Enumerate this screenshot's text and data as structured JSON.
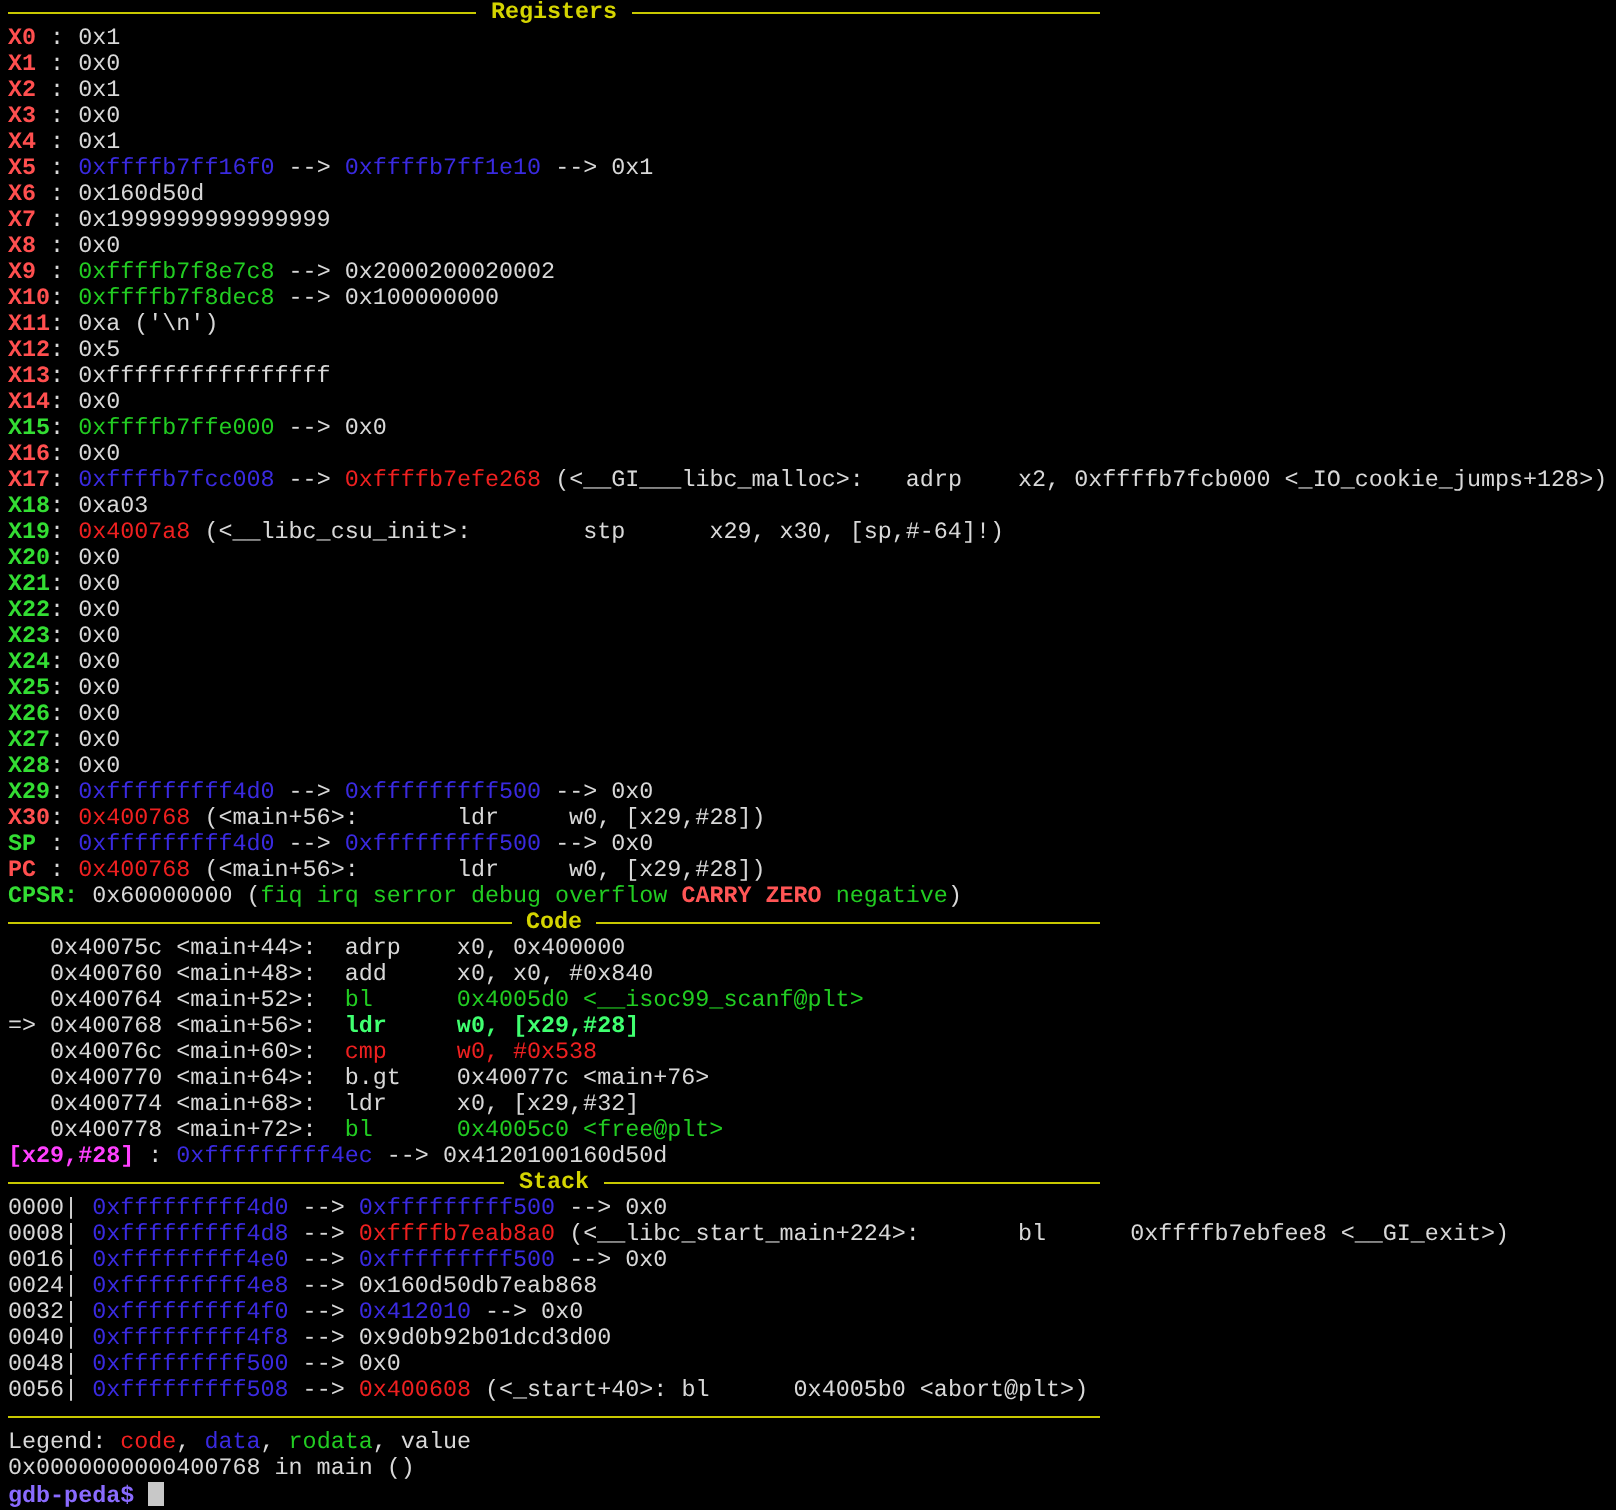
{
  "panels": [
    {
      "title": "Registers",
      "lines": [
        [
          {
            "text": "X0",
            "kind": "reg_changed"
          },
          {
            "text": " : 0x1"
          }
        ],
        [
          {
            "text": "X1",
            "kind": "reg_changed"
          },
          {
            "text": " : 0x0"
          }
        ],
        [
          {
            "text": "X2",
            "kind": "reg_changed"
          },
          {
            "text": " : 0x1"
          }
        ],
        [
          {
            "text": "X3",
            "kind": "reg_changed"
          },
          {
            "text": " : 0x0"
          }
        ],
        [
          {
            "text": "X4",
            "kind": "reg_changed"
          },
          {
            "text": " : 0x1"
          }
        ],
        [
          {
            "text": "X5",
            "kind": "reg_changed"
          },
          {
            "text": " : "
          },
          {
            "text": "0xffffb7ff16f0",
            "kind": "data"
          },
          {
            "text": " --> "
          },
          {
            "text": "0xffffb7ff1e10",
            "kind": "data"
          },
          {
            "text": " --> 0x1"
          }
        ],
        [
          {
            "text": "X6",
            "kind": "reg_changed"
          },
          {
            "text": " : 0x160d50d"
          }
        ],
        [
          {
            "text": "X7",
            "kind": "reg_changed"
          },
          {
            "text": " : 0x1999999999999999"
          }
        ],
        [
          {
            "text": "X8",
            "kind": "reg_changed"
          },
          {
            "text": " : 0x0"
          }
        ],
        [
          {
            "text": "X9",
            "kind": "reg_changed"
          },
          {
            "text": " : "
          },
          {
            "text": "0xffffb7f8e7c8",
            "kind": "rodata"
          },
          {
            "text": " --> 0x2000200020002"
          }
        ],
        [
          {
            "text": "X10",
            "kind": "reg_changed"
          },
          {
            "text": ": "
          },
          {
            "text": "0xffffb7f8dec8",
            "kind": "rodata"
          },
          {
            "text": " --> 0x100000000"
          }
        ],
        [
          {
            "text": "X11",
            "kind": "reg_changed"
          },
          {
            "text": ": 0xa ('\\n')"
          }
        ],
        [
          {
            "text": "X12",
            "kind": "reg_changed"
          },
          {
            "text": ": 0x5"
          }
        ],
        [
          {
            "text": "X13",
            "kind": "reg_changed"
          },
          {
            "text": ": 0xffffffffffffffff"
          }
        ],
        [
          {
            "text": "X14",
            "kind": "reg_changed"
          },
          {
            "text": ": 0x0"
          }
        ],
        [
          {
            "text": "X15",
            "kind": "reg"
          },
          {
            "text": ": "
          },
          {
            "text": "0xffffb7ffe000",
            "kind": "rodata"
          },
          {
            "text": " --> 0x0"
          }
        ],
        [
          {
            "text": "X16",
            "kind": "reg_changed"
          },
          {
            "text": ": 0x0"
          }
        ],
        [
          {
            "text": "X17",
            "kind": "reg_changed"
          },
          {
            "text": ": "
          },
          {
            "text": "0xffffb7fcc008",
            "kind": "data"
          },
          {
            "text": " --> "
          },
          {
            "text": "0xffffb7efe268",
            "kind": "code"
          },
          {
            "text": " (<__GI___libc_malloc>:   adrp    x2, 0xffffb7fcb000 <_IO_cookie_jumps+128>)"
          }
        ],
        [
          {
            "text": "X18",
            "kind": "reg"
          },
          {
            "text": ": 0xa03"
          }
        ],
        [
          {
            "text": "X19",
            "kind": "reg"
          },
          {
            "text": ": "
          },
          {
            "text": "0x4007a8",
            "kind": "code"
          },
          {
            "text": " (<__libc_csu_init>:        stp      x29, x30, [sp,#-64]!)"
          }
        ],
        [
          {
            "text": "X20",
            "kind": "reg"
          },
          {
            "text": ": 0x0"
          }
        ],
        [
          {
            "text": "X21",
            "kind": "reg"
          },
          {
            "text": ": 0x0"
          }
        ],
        [
          {
            "text": "X22",
            "kind": "reg"
          },
          {
            "text": ": 0x0"
          }
        ],
        [
          {
            "text": "X23",
            "kind": "reg"
          },
          {
            "text": ": 0x0"
          }
        ],
        [
          {
            "text": "X24",
            "kind": "reg"
          },
          {
            "text": ": 0x0"
          }
        ],
        [
          {
            "text": "X25",
            "kind": "reg"
          },
          {
            "text": ": 0x0"
          }
        ],
        [
          {
            "text": "X26",
            "kind": "reg"
          },
          {
            "text": ": 0x0"
          }
        ],
        [
          {
            "text": "X27",
            "kind": "reg"
          },
          {
            "text": ": 0x0"
          }
        ],
        [
          {
            "text": "X28",
            "kind": "reg"
          },
          {
            "text": ": 0x0"
          }
        ],
        [
          {
            "text": "X29",
            "kind": "reg"
          },
          {
            "text": ": "
          },
          {
            "text": "0xfffffffff4d0",
            "kind": "data"
          },
          {
            "text": " --> "
          },
          {
            "text": "0xfffffffff500",
            "kind": "data"
          },
          {
            "text": " --> 0x0"
          }
        ],
        [
          {
            "text": "X30",
            "kind": "reg_changed"
          },
          {
            "text": ": "
          },
          {
            "text": "0x400768",
            "kind": "code"
          },
          {
            "text": " (<main+56>:       ldr     w0, [x29,#28])"
          }
        ],
        [
          {
            "text": "SP",
            "kind": "reg"
          },
          {
            "text": " : "
          },
          {
            "text": "0xfffffffff4d0",
            "kind": "data"
          },
          {
            "text": " --> "
          },
          {
            "text": "0xfffffffff500",
            "kind": "data"
          },
          {
            "text": " --> 0x0"
          }
        ],
        [
          {
            "text": "PC",
            "kind": "reg_changed"
          },
          {
            "text": " : "
          },
          {
            "text": "0x400768",
            "kind": "code"
          },
          {
            "text": " (<main+56>:       ldr     w0, [x29,#28])"
          }
        ],
        [
          {
            "text": "CPSR:",
            "kind": "reg"
          },
          {
            "text": " 0x60000000 ("
          },
          {
            "text": "fiq irq serror debug overflow ",
            "kind": "rodata"
          },
          {
            "text": "CARRY ZERO",
            "kind": "flag_set"
          },
          {
            "text": " negative",
            "kind": "rodata"
          },
          {
            "text": ")"
          }
        ]
      ]
    },
    {
      "title": "Code",
      "lines": [
        [
          {
            "text": "   0x40075c <main+44>:  adrp    x0, 0x400000"
          }
        ],
        [
          {
            "text": "   0x400760 <main+48>:  add     x0, x0, #0x840"
          }
        ],
        [
          {
            "text": "   0x400764 <main+52>:  "
          },
          {
            "text": "bl      0x4005d0 <__isoc99_scanf@plt>",
            "kind": "rodata"
          }
        ],
        [
          {
            "text": "=> 0x400768 <main+56>:  "
          },
          {
            "text": "ldr     w0, [x29,#28]",
            "kind": "current"
          }
        ],
        [
          {
            "text": "   0x40076c <main+60>:  "
          },
          {
            "text": "cmp     w0, #0x538",
            "kind": "code"
          }
        ],
        [
          {
            "text": "   0x400770 <main+64>:  b.gt    0x40077c <main+76>"
          }
        ],
        [
          {
            "text": "   0x400774 <main+68>:  ldr     x0, [x29,#32]"
          }
        ],
        [
          {
            "text": "   0x400778 <main+72>:  "
          },
          {
            "text": "bl      0x4005c0 <free@plt>",
            "kind": "rodata"
          }
        ],
        [
          {
            "text": "[x29,#28]",
            "kind": "expr"
          },
          {
            "text": " : "
          },
          {
            "text": "0xfffffffff4ec",
            "kind": "data"
          },
          {
            "text": " --> 0x4120100160d50d"
          }
        ]
      ]
    },
    {
      "title": "Stack",
      "lines": [
        [
          {
            "text": "0000| "
          },
          {
            "text": "0xfffffffff4d0",
            "kind": "data"
          },
          {
            "text": " --> "
          },
          {
            "text": "0xfffffffff500",
            "kind": "data"
          },
          {
            "text": " --> 0x0"
          }
        ],
        [
          {
            "text": "0008| "
          },
          {
            "text": "0xfffffffff4d8",
            "kind": "data"
          },
          {
            "text": " --> "
          },
          {
            "text": "0xffffb7eab8a0",
            "kind": "code"
          },
          {
            "text": " (<__libc_start_main+224>:       bl      0xffffb7ebfee8 <__GI_exit>)"
          }
        ],
        [
          {
            "text": "0016| "
          },
          {
            "text": "0xfffffffff4e0",
            "kind": "data"
          },
          {
            "text": " --> "
          },
          {
            "text": "0xfffffffff500",
            "kind": "data"
          },
          {
            "text": " --> 0x0"
          }
        ],
        [
          {
            "text": "0024| "
          },
          {
            "text": "0xfffffffff4e8",
            "kind": "data"
          },
          {
            "text": " --> 0x160d50db7eab868"
          }
        ],
        [
          {
            "text": "0032| "
          },
          {
            "text": "0xfffffffff4f0",
            "kind": "data"
          },
          {
            "text": " --> "
          },
          {
            "text": "0x412010",
            "kind": "data"
          },
          {
            "text": " --> 0x0"
          }
        ],
        [
          {
            "text": "0040| "
          },
          {
            "text": "0xfffffffff4f8",
            "kind": "data"
          },
          {
            "text": " --> 0x9d0b92b01dcd3d00"
          }
        ],
        [
          {
            "text": "0048| "
          },
          {
            "text": "0xfffffffff500",
            "kind": "data"
          },
          {
            "text": " --> 0x0"
          }
        ],
        [
          {
            "text": "0056| "
          },
          {
            "text": "0xfffffffff508",
            "kind": "data"
          },
          {
            "text": " --> "
          },
          {
            "text": "0x400608",
            "kind": "code"
          },
          {
            "text": " (<_start+40>: bl      0x4005b0 <abort@plt>)"
          }
        ]
      ]
    }
  ],
  "footer": [
    [
      {
        "text": "Legend: "
      },
      {
        "text": "code",
        "kind": "code"
      },
      {
        "text": ", "
      },
      {
        "text": "data",
        "kind": "data"
      },
      {
        "text": ", "
      },
      {
        "text": "rodata",
        "kind": "rodata"
      },
      {
        "text": ", value"
      }
    ],
    [
      {
        "text": "0x0000000000400768 in main ()"
      }
    ]
  ],
  "prompt": {
    "text": "gdb-peda$",
    "cursor": true
  }
}
